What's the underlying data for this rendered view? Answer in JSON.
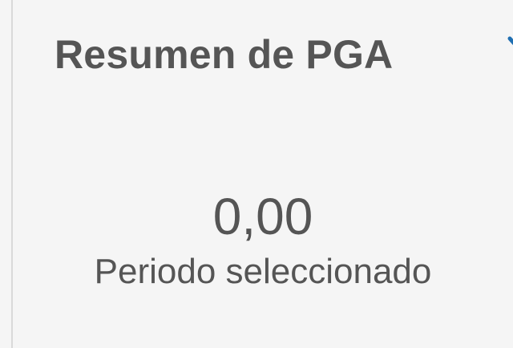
{
  "card": {
    "title": "Resumen de PGA",
    "expand_icon": "chevron-down-icon",
    "accent_color": "#1f6fb2",
    "metric": {
      "value": "0,00",
      "label": "Periodo seleccionado"
    }
  }
}
